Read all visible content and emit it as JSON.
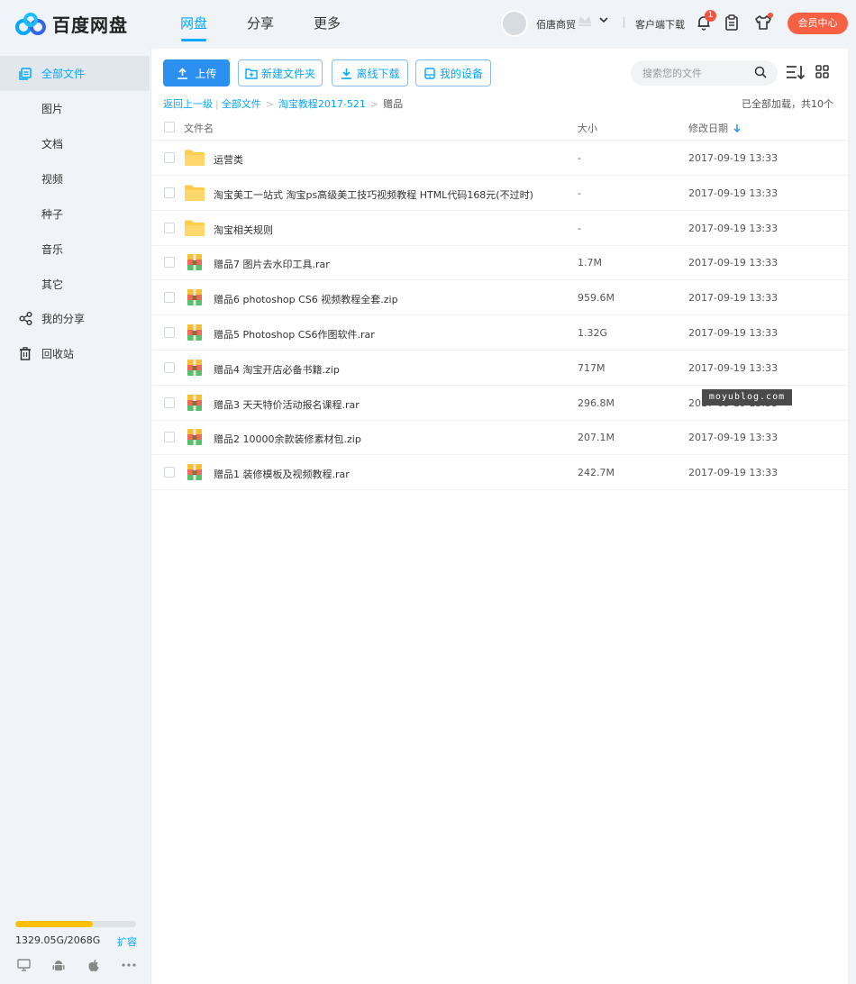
{
  "app": {
    "logo_text": "百度网盘",
    "accent": "#06a7ff"
  },
  "nav": [
    {
      "label": "网盘",
      "active": true
    },
    {
      "label": "分享",
      "active": false
    },
    {
      "label": "更多",
      "active": false
    }
  ],
  "user": {
    "name": "佰唐商贸",
    "client_download": "客户端下载",
    "notification_count": "1",
    "vip_center": "会员中心"
  },
  "sidebar": {
    "items": [
      {
        "label": "全部文件",
        "icon": "all-files-icon",
        "active": true
      },
      {
        "label": "图片"
      },
      {
        "label": "文档"
      },
      {
        "label": "视频"
      },
      {
        "label": "种子"
      },
      {
        "label": "音乐"
      },
      {
        "label": "其它"
      },
      {
        "label": "我的分享",
        "icon": "share-icon"
      },
      {
        "label": "回收站",
        "icon": "trash-icon"
      }
    ],
    "quota": {
      "text": "1329.05G/2068G",
      "used_fraction": 0.643,
      "expand": "扩容"
    },
    "devices": [
      "pc-icon",
      "android-icon",
      "apple-icon",
      "more-icon"
    ]
  },
  "toolbar": {
    "upload": "上传",
    "new_folder": "新建文件夹",
    "offline_download": "离线下载",
    "my_devices": "我的设备",
    "search_placeholder": "搜索您的文件"
  },
  "breadcrumb": {
    "back": "返回上一级",
    "sep_bar": "|",
    "sep": ">",
    "items": [
      "全部文件",
      "淘宝教程2017-521"
    ],
    "current": "赠品"
  },
  "loaded_text": "已全部加载，共10个",
  "table": {
    "headers": {
      "name": "文件名",
      "size": "大小",
      "date": "修改日期"
    },
    "rows": [
      {
        "name": "运营类",
        "size": "-",
        "date": "2017-09-19 13:33",
        "type": "folder"
      },
      {
        "name": "淘宝美工一站式 淘宝ps高级美工技巧视频教程 HTML代码168元(不过时)",
        "size": "-",
        "date": "2017-09-19 13:33",
        "type": "folder"
      },
      {
        "name": "淘宝相关规则",
        "size": "-",
        "date": "2017-09-19 13:33",
        "type": "folder"
      },
      {
        "name": "赠品7 图片去水印工具.rar",
        "size": "1.7M",
        "date": "2017-09-19 13:33",
        "type": "archive"
      },
      {
        "name": "赠品6 photoshop CS6 视频教程全套.zip",
        "size": "959.6M",
        "date": "2017-09-19 13:33",
        "type": "archive"
      },
      {
        "name": "赠品5 Photoshop CS6作图软件.rar",
        "size": "1.32G",
        "date": "2017-09-19 13:33",
        "type": "archive"
      },
      {
        "name": "赠品4 淘宝开店必备书籍.zip",
        "size": "717M",
        "date": "2017-09-19 13:33",
        "type": "archive"
      },
      {
        "name": "赠品3 天天特价活动报名课程.rar",
        "size": "296.8M",
        "date": "2017-09-19 13:33",
        "type": "archive"
      },
      {
        "name": "赠品2 10000余款装修素材包.zip",
        "size": "207.1M",
        "date": "2017-09-19 13:33",
        "type": "archive"
      },
      {
        "name": "赠品1 装修模板及视频教程.rar",
        "size": "242.7M",
        "date": "2017-09-19 13:33",
        "type": "archive"
      }
    ]
  },
  "watermark": "moyublog.com"
}
